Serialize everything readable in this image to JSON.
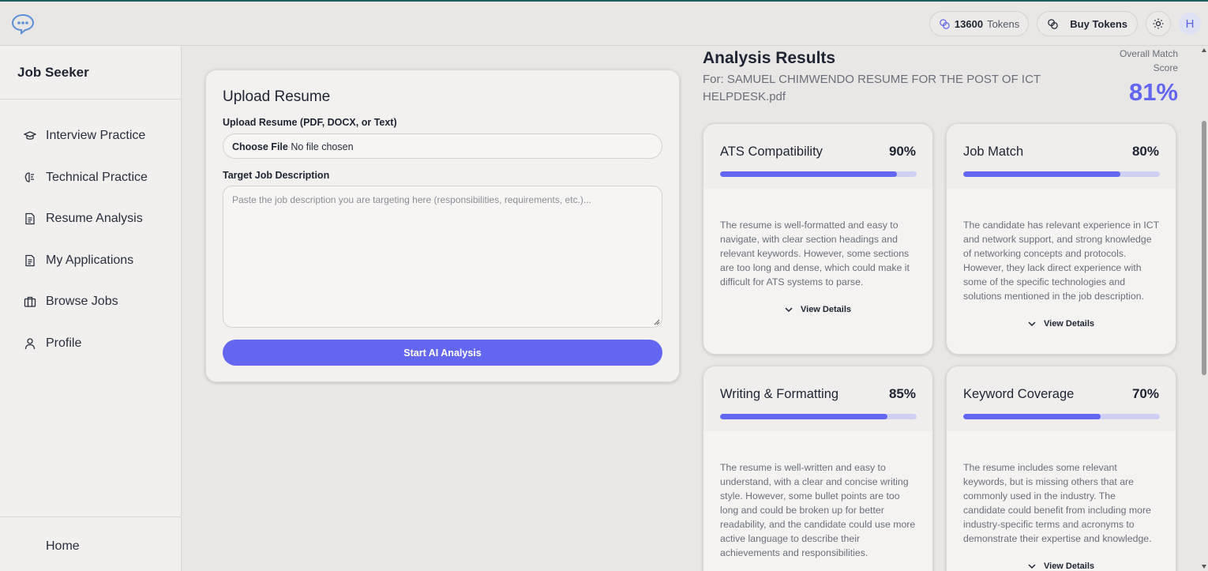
{
  "header": {
    "tokens_count": "13600",
    "tokens_label": "Tokens",
    "buy_tokens_label": "Buy Tokens",
    "avatar_initial": "H"
  },
  "sidebar": {
    "title": "Job Seeker",
    "items": [
      {
        "label": "Interview Practice",
        "icon": "graduation-cap-icon"
      },
      {
        "label": "Technical Practice",
        "icon": "brain-icon"
      },
      {
        "label": "Resume Analysis",
        "icon": "document-icon"
      },
      {
        "label": "My Applications",
        "icon": "document-icon"
      },
      {
        "label": "Browse Jobs",
        "icon": "briefcase-icon"
      },
      {
        "label": "Profile",
        "icon": "user-icon"
      }
    ],
    "bottom_item": "Home"
  },
  "upload": {
    "title": "Upload Resume",
    "file_label": "Upload Resume (PDF, DOCX, or Text)",
    "choose_file": "Choose File",
    "no_file": "No file chosen",
    "job_desc_label": "Target Job Description",
    "job_desc_placeholder": "Paste the job description you are targeting here (responsibilities, requirements, etc.)...",
    "start_button": "Start AI Analysis"
  },
  "results": {
    "title": "Analysis Results",
    "for_text": "For: SAMUEL CHIMWENDO RESUME FOR THE POST OF ICT HELPDESK.pdf",
    "overall_label": "Overall Match Score",
    "overall_score": "81%",
    "view_details": "View Details",
    "metrics": [
      {
        "name": "ATS Compatibility",
        "value": "90%",
        "fraction": 0.9,
        "text": "The resume is well-formatted and easy to navigate, with clear section headings and relevant keywords. However, some sections are too long and dense, which could make it difficult for ATS systems to parse."
      },
      {
        "name": "Job Match",
        "value": "80%",
        "fraction": 0.8,
        "text": "The candidate has relevant experience in ICT and network support, and strong knowledge of networking concepts and protocols. However, they lack direct experience with some of the specific technologies and solutions mentioned in the job description."
      },
      {
        "name": "Writing & Formatting",
        "value": "85%",
        "fraction": 0.85,
        "text": "The resume is well-written and easy to understand, with a clear and concise writing style. However, some bullet points are too long and could be broken up for better readability, and the candidate could use more active language to describe their achievements and responsibilities."
      },
      {
        "name": "Keyword Coverage",
        "value": "70%",
        "fraction": 0.7,
        "text": "The resume includes some relevant keywords, but is missing others that are commonly used in the industry. The candidate could benefit from including more industry-specific terms and acronyms to demonstrate their expertise and knowledge."
      }
    ]
  },
  "colors": {
    "accent": "#6366f1",
    "track": "#cfd0f4"
  }
}
